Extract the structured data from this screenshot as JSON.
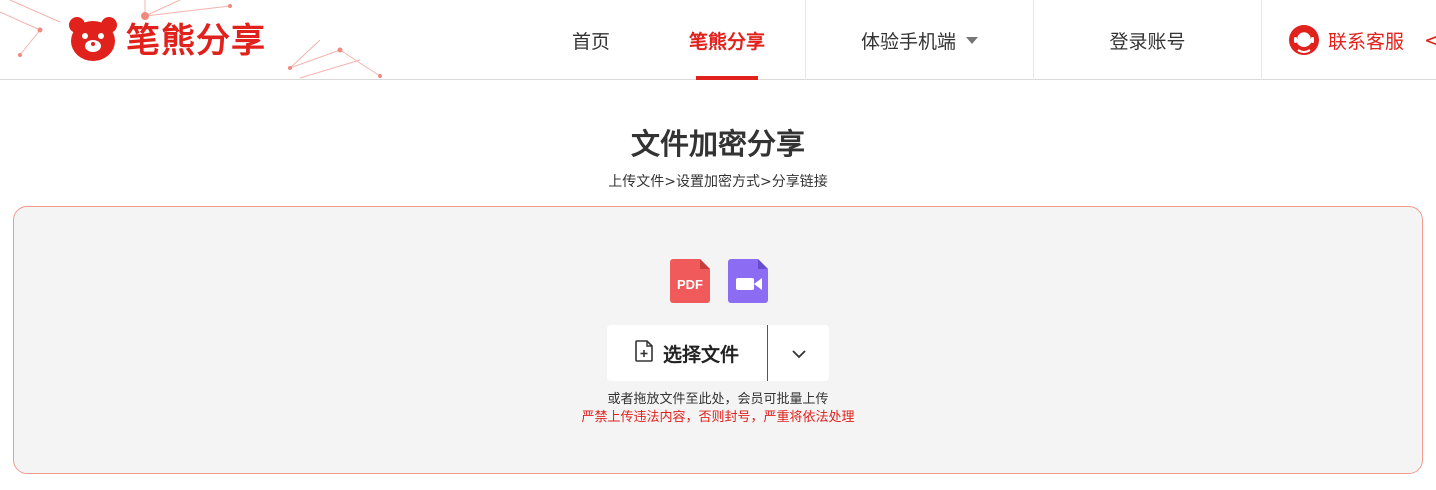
{
  "brand": {
    "name": "笔熊分享",
    "color": "#e0211c",
    "logo_icon": "bear-logo-icon"
  },
  "nav": {
    "items": [
      {
        "label": "首页",
        "active": false
      },
      {
        "label": "笔熊分享",
        "active": true
      },
      {
        "label": "体验手机端",
        "active": false,
        "has_dropdown": true
      },
      {
        "label": "登录账号",
        "active": false
      }
    ],
    "service": {
      "label": "联系客服",
      "icon": "customer-service-icon"
    },
    "edge_arrow": "<"
  },
  "page": {
    "title": "文件加密分享",
    "steps": "上传文件>设置加密方式>分享链接"
  },
  "upload": {
    "file_type_icons": [
      {
        "name": "pdf-file-icon",
        "label": "PDF",
        "color": "#f15a5a"
      },
      {
        "name": "video-file-icon",
        "label": "",
        "color": "#8b6cf2"
      }
    ],
    "button_label": "选择文件",
    "button_icon": "file-add-icon",
    "dropdown_icon": "chevron-down-icon",
    "hint": "或者拖放文件至此处，会员可批量上传",
    "warning": "严禁上传违法内容，否则封号，严重将依法处理",
    "border_color": "#f29a8e",
    "background": "#f4f4f4"
  }
}
